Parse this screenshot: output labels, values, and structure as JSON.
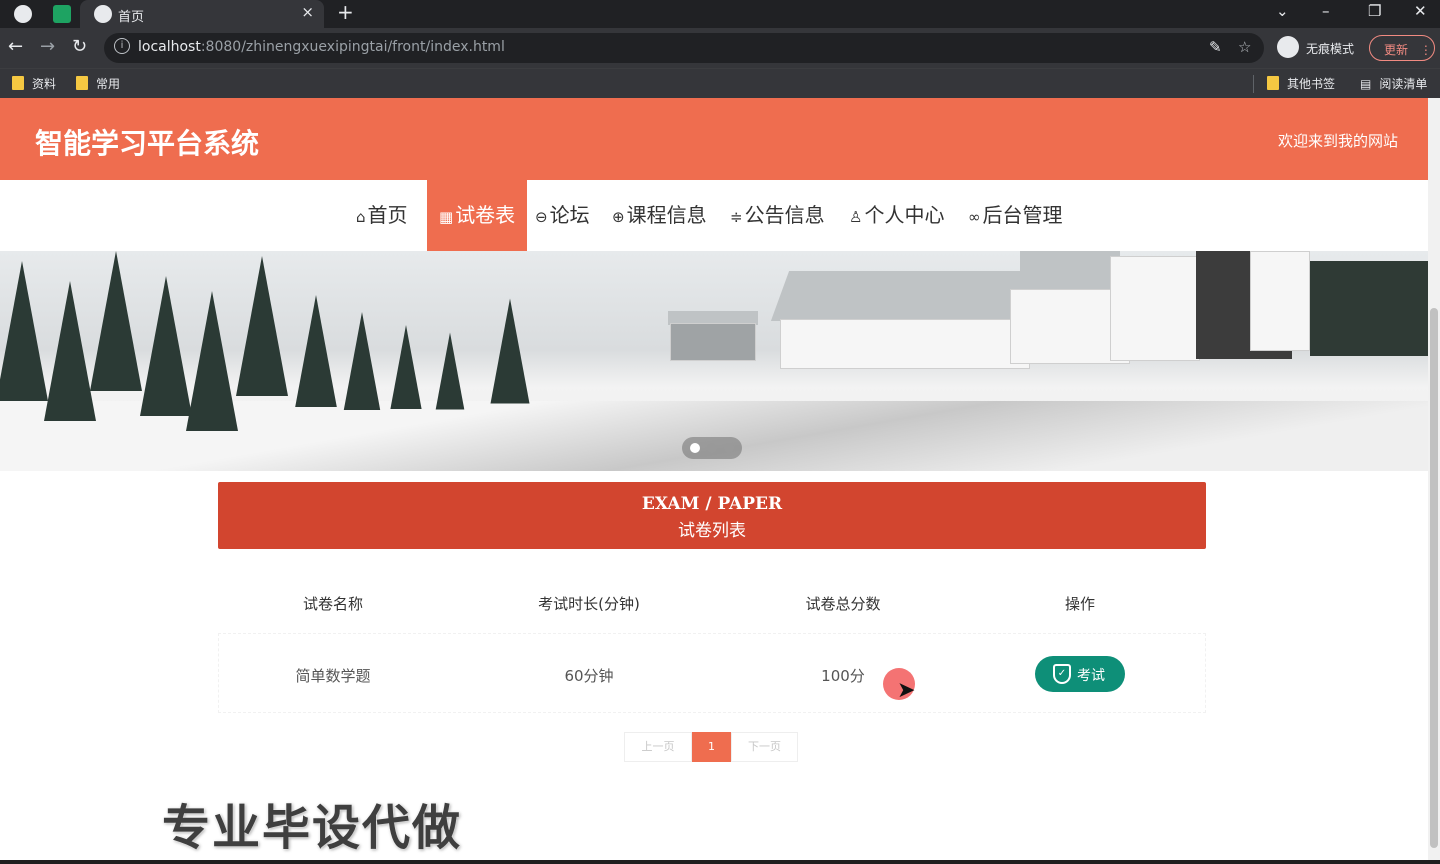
{
  "browser": {
    "tab_title": "首页",
    "tab_close": "×",
    "new_tab": "+",
    "url_host": "localhost",
    "url_rest": ":8080/zhinengxuexipingtai/front/index.html",
    "incognito_label": "无痕模式",
    "update_label": "更新",
    "bookmarks": [
      "资料",
      "常用"
    ],
    "other_bookmarks": "其他书签",
    "reading_list": "阅读清单"
  },
  "site": {
    "title": "智能学习平台系统",
    "welcome": "欢迎来到我的网站"
  },
  "nav": {
    "items": [
      {
        "label": "首页",
        "icon": "home-icon",
        "glyph": "⌂"
      },
      {
        "label": "试卷表",
        "icon": "paper-icon",
        "glyph": "▦"
      },
      {
        "label": "论坛",
        "icon": "forum-icon",
        "glyph": "⊖"
      },
      {
        "label": "课程信息",
        "icon": "globe-icon",
        "glyph": "⊕"
      },
      {
        "label": "公告信息",
        "icon": "notice-icon",
        "glyph": "≑"
      },
      {
        "label": "个人中心",
        "icon": "user-icon",
        "glyph": "♙"
      },
      {
        "label": "后台管理",
        "icon": "link-icon",
        "glyph": "∞"
      }
    ],
    "active_index": 1
  },
  "banner": {
    "slide_count": 3,
    "active_slide": 0
  },
  "section": {
    "title_en": "EXAM / PAPER",
    "title_cn": "试卷列表"
  },
  "table": {
    "headers": [
      "试卷名称",
      "考试时长(分钟)",
      "试卷总分数",
      "操作"
    ],
    "rows": [
      {
        "name": "简单数学题",
        "duration": "60分钟",
        "score": "100分",
        "action": "考试"
      }
    ]
  },
  "pager": {
    "prev": "上一页",
    "current": "1",
    "next": "下一页"
  },
  "watermark": "专业毕设代做",
  "colors": {
    "brand": "#ef6d4f",
    "section": "#d2452f",
    "action": "#0e8f78"
  }
}
